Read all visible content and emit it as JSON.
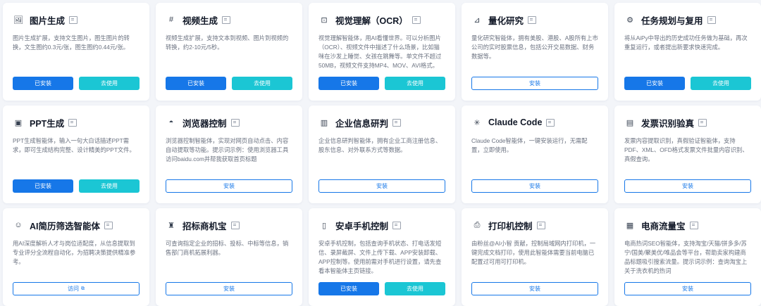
{
  "cards": [
    {
      "title": "图片生成",
      "icon": "🖼",
      "desc": "图片生成扩展，支持文生图片，图生图片的转换，文生图约0.3元/张，图生图约0.44元/张。",
      "buttons": [
        {
          "label": "已安装",
          "style": "installed"
        },
        {
          "label": "去使用",
          "style": "use"
        }
      ]
    },
    {
      "title": "视频生成",
      "icon": "#",
      "desc": "视频生成扩展，支持文本到视频、图片到视频的转换，约2-10元/5秒。",
      "buttons": [
        {
          "label": "已安装",
          "style": "installed"
        },
        {
          "label": "去使用",
          "style": "use"
        }
      ]
    },
    {
      "title": "视觉理解（OCR）",
      "icon": "⊡",
      "desc": "视觉理解智能体，用AI看懂世界。可以分析图片（OCR）、视频文件中描述了什么场景，比如猫咪在沙发上睡觉、女孩在跳舞等。单文件不超过50MB，视频文件支持MP4、MOV、AVI格式。",
      "buttons": [
        {
          "label": "已安装",
          "style": "installed"
        },
        {
          "label": "去使用",
          "style": "use"
        }
      ]
    },
    {
      "title": "量化研究",
      "icon": "⊿",
      "desc": "量化研究智能体，拥有美股、港股、A股所有上市公司的实时股票信息，包括公开交易数据、财务数据等。",
      "buttons": [
        {
          "label": "安装",
          "style": "outline"
        }
      ]
    },
    {
      "title": "任务规划与复用",
      "icon": "⚙",
      "desc": "将从AiPy中导出的历史成功任务做为基础，再次重复运行，或者提出新要求快速完成。",
      "buttons": [
        {
          "label": "已安装",
          "style": "installed"
        },
        {
          "label": "去使用",
          "style": "use"
        }
      ]
    },
    {
      "title": "PPT生成",
      "icon": "▣",
      "desc": "PPT生成智能体，输入一句大白话描述PPT需求，即可生成结构完整、设计精美的PPT文件。",
      "buttons": [
        {
          "label": "已安装",
          "style": "installed"
        },
        {
          "label": "去使用",
          "style": "use"
        }
      ]
    },
    {
      "title": "浏览器控制",
      "icon": "◓",
      "desc": "浏览器控制智能体，实现对网页自动点击、内容自动提取等功能。提示词示例：使用浏览器工具访问baidu.com并帮我获取首页标题",
      "buttons": [
        {
          "label": "安装",
          "style": "outline"
        }
      ]
    },
    {
      "title": "企业信息研判",
      "icon": "▥",
      "desc": "企业信息研判智能体，拥有企业工商注册信息、股东信息、对外联系方式等数据。",
      "buttons": [
        {
          "label": "安装",
          "style": "outline"
        }
      ]
    },
    {
      "title": "Claude Code",
      "icon": "✳",
      "desc": "Claude Code智能体，一键安装运行，无需配置，立即使用。",
      "buttons": [
        {
          "label": "安装",
          "style": "outline"
        }
      ]
    },
    {
      "title": "发票识别验真",
      "icon": "▤",
      "desc": "发票内容提取识别，真假验证智能体，支持PDF、XML、OFD格式发票文件批量内容识别、真假查询。",
      "buttons": [
        {
          "label": "安装",
          "style": "outline"
        }
      ]
    },
    {
      "title": "AI简历筛选智能体",
      "icon": "☺",
      "desc": "用AI深度解析人才与岗位适配度，从信息提取到专业评分全流程自动化，为招聘决策提供精准参考。",
      "buttons": [
        {
          "label": "访问",
          "style": "outline",
          "ext": true
        }
      ]
    },
    {
      "title": "招标商机宝",
      "icon": "♜",
      "desc": "可查询指定企业的招标、投标、中标等信息，销售部门商机拓展利器。",
      "buttons": [
        {
          "label": "安装",
          "style": "outline"
        }
      ]
    },
    {
      "title": "安卓手机控制",
      "icon": "▯",
      "desc": "安卓手机控制，包括查询手机状态、打电话发短信、录屏截屏、文件上传下载、APP安装卸载、APP控制等。使用前需对手机进行设置，请先查看本智能体主页链接。",
      "buttons": [
        {
          "label": "已安装",
          "style": "installed"
        },
        {
          "label": "去使用",
          "style": "use"
        }
      ]
    },
    {
      "title": "打印机控制",
      "icon": "⎙",
      "desc": "由粉丝@AI小智 贡献，控制局域网内打印机，一键完成文档打印，使用此智能体需要当前电脑已配置过可用可打印机。",
      "buttons": [
        {
          "label": "安装",
          "style": "outline"
        }
      ]
    },
    {
      "title": "电商流量宝",
      "icon": "▦",
      "desc": "电商热词SEO智能体，支持淘宝/天猫/拼多多/苏宁/国美/聚美优/唯品会等平台，帮助卖家构建商品标题吸引搜索流量。提示词示例：查询淘宝上关于洗衣机的热词",
      "buttons": [
        {
          "label": "安装",
          "style": "outline"
        }
      ]
    }
  ]
}
